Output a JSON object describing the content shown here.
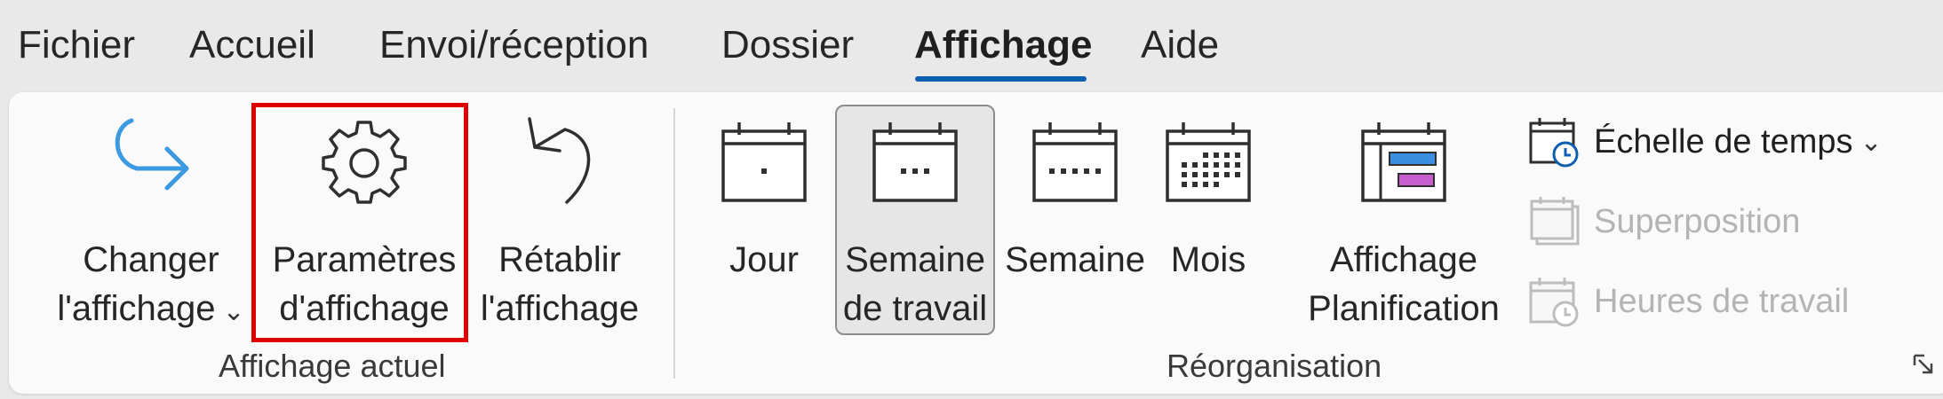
{
  "tabs": [
    {
      "label": "Fichier",
      "active": false
    },
    {
      "label": "Accueil",
      "active": false
    },
    {
      "label": "Envoi/réception",
      "active": false
    },
    {
      "label": "Dossier",
      "active": false
    },
    {
      "label": "Affichage",
      "active": true
    },
    {
      "label": "Aide",
      "active": false
    }
  ],
  "groups": {
    "current_view": {
      "label": "Affichage actuel",
      "change_view": {
        "line1": "Changer",
        "line2": "l'affichage",
        "chevron": "⌄",
        "icon": "redirect-arrow-icon"
      },
      "view_settings": {
        "line1": "Paramètres",
        "line2": "d'affichage",
        "icon": "gear-icon"
      },
      "reset_view": {
        "line1": "Rétablir",
        "line2": "l'affichage",
        "icon": "undo-arrow-icon"
      }
    },
    "arrangement": {
      "label": "Réorganisation",
      "day": {
        "line1": "Jour",
        "icon": "calendar-day-icon"
      },
      "work_week": {
        "line1": "Semaine",
        "line2": "de travail",
        "selected": true,
        "icon": "calendar-work-week-icon"
      },
      "week": {
        "line1": "Semaine",
        "icon": "calendar-week-icon"
      },
      "month": {
        "line1": "Mois",
        "icon": "calendar-month-icon"
      },
      "schedule_view": {
        "line1": "Affichage",
        "line2": "Planification",
        "icon": "calendar-schedule-icon"
      },
      "time_scale": {
        "label": "Échelle de temps",
        "chevron": "⌄",
        "icon": "calendar-clock-icon"
      },
      "overlay": {
        "label": "Superposition",
        "disabled": true,
        "icon": "calendar-overlay-icon"
      },
      "working_hours": {
        "label": "Heures de travail",
        "disabled": true,
        "icon": "calendar-clock-icon"
      }
    }
  },
  "colors": {
    "accent": "#0f5fb0",
    "highlight": "#e00000",
    "icon_blue": "#3b9ae1",
    "schedule_blue": "#3b8ee0",
    "schedule_purple": "#c65ed0",
    "disabled_text": "#b4b4b4"
  }
}
